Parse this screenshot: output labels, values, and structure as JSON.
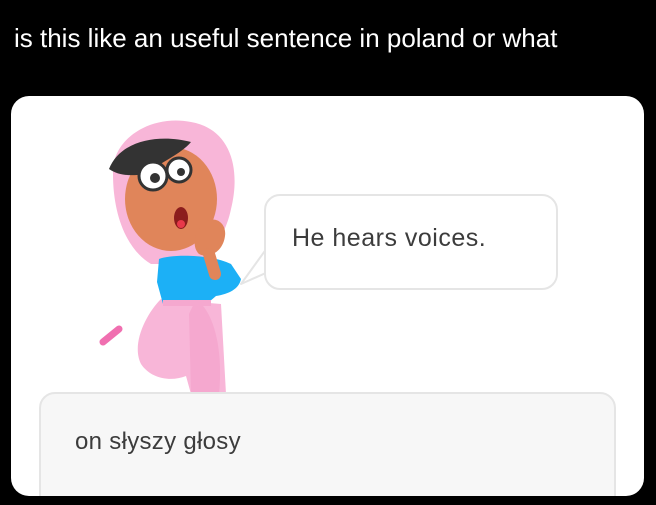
{
  "caption": "is this like an useful sentence in poland or what",
  "exercise": {
    "prompt_sentence": "He hears voices.",
    "answer_text": "on słyszy głosy"
  },
  "icons": {
    "character": "duolingo-character-lily-icon"
  },
  "colors": {
    "background": "#000000",
    "card": "#ffffff",
    "bubble_border": "#e5e5e5",
    "answer_bg": "#f7f7f7",
    "text": "#3c3c3c",
    "character_hood": "#f8b6d8",
    "character_shirt": "#1cb0f6",
    "character_skin": "#e0855a"
  }
}
